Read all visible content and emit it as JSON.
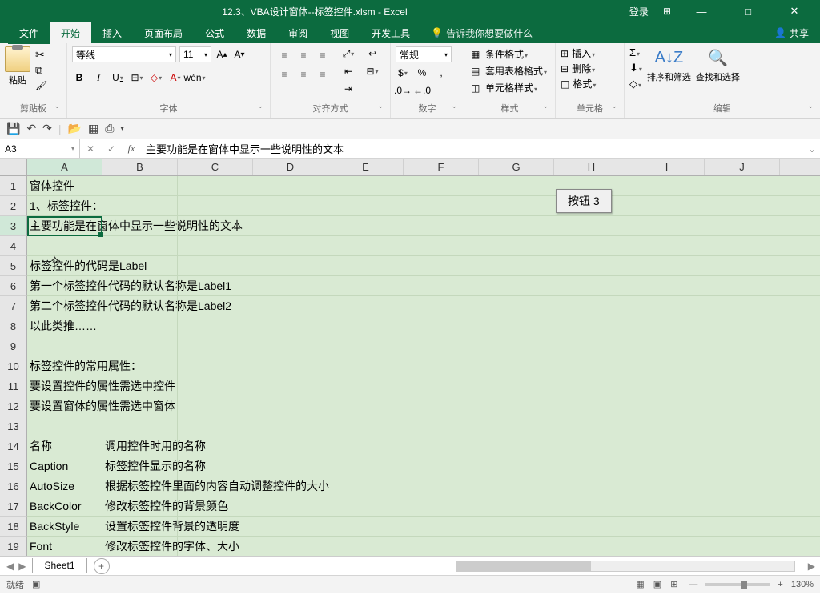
{
  "title": "12.3、VBA设计窗体--标签控件.xlsm  -  Excel",
  "title_right": {
    "login": "登录",
    "team_icon": "⊞"
  },
  "tabs": {
    "file": "文件",
    "home": "开始",
    "insert": "插入",
    "layout": "页面布局",
    "formula": "公式",
    "data": "数据",
    "review": "审阅",
    "view": "视图",
    "dev": "开发工具",
    "tellme": "告诉我你想要做什么",
    "share": "共享"
  },
  "ribbon": {
    "clipboard": {
      "paste": "粘贴",
      "label": "剪贴板"
    },
    "font": {
      "name": "等线",
      "size": "11",
      "label": "字体"
    },
    "align": {
      "label": "对齐方式"
    },
    "number": {
      "format": "常规",
      "label": "数字"
    },
    "styles": {
      "cond": "条件格式",
      "table": "套用表格格式",
      "cell": "单元格样式",
      "label": "样式"
    },
    "cells": {
      "insert": "插入",
      "delete": "删除",
      "format": "格式",
      "label": "单元格"
    },
    "edit": {
      "sort": "排序和筛选",
      "find": "查找和选择",
      "label": "编辑"
    }
  },
  "name_box": "A3",
  "formula_bar": "主要功能是在窗体中显示一些说明性的文本",
  "columns": [
    "A",
    "B",
    "C",
    "D",
    "E",
    "F",
    "G",
    "H",
    "I",
    "J"
  ],
  "active_col": "A",
  "active_row": 3,
  "rows": [
    {
      "n": 1,
      "a": "窗体控件"
    },
    {
      "n": 2,
      "a": "1、标签控件："
    },
    {
      "n": 3,
      "a": "主要功能是",
      "overflow": "在窗体中显示一些说明性的文本"
    },
    {
      "n": 4,
      "a": ""
    },
    {
      "n": 5,
      "a": "标签控件的代码是Label"
    },
    {
      "n": 6,
      "a": "第一个标签控件代码的默认名称是Label1"
    },
    {
      "n": 7,
      "a": "第二个标签控件代码的默认名称是Label2"
    },
    {
      "n": 8,
      "a": "以此类推……"
    },
    {
      "n": 9,
      "a": ""
    },
    {
      "n": 10,
      "a": "标签控件的常用属性："
    },
    {
      "n": 11,
      "a": "要设置控件的属性需选中控件"
    },
    {
      "n": 12,
      "a": "要设置窗体的属性需选中窗体"
    },
    {
      "n": 13,
      "a": ""
    },
    {
      "n": 14,
      "a": "名称",
      "b": "调用控件时用的名称"
    },
    {
      "n": 15,
      "a": "Caption",
      "b": "标签控件显示的名称"
    },
    {
      "n": 16,
      "a": "AutoSize",
      "b": "根据标签控件里面的内容自动调整控件的大小"
    },
    {
      "n": 17,
      "a": "BackColor",
      "b": "修改标签控件的背景颜色"
    },
    {
      "n": 18,
      "a": "BackStyle",
      "b": "设置标签控件背景的透明度"
    },
    {
      "n": 19,
      "a": "Font",
      "b": "修改标签控件的字体、大小"
    }
  ],
  "sheet_button": "按钮 3",
  "sheet_tab": "Sheet1",
  "status": {
    "ready": "就绪",
    "zoom": "130%"
  },
  "chart_data": null
}
